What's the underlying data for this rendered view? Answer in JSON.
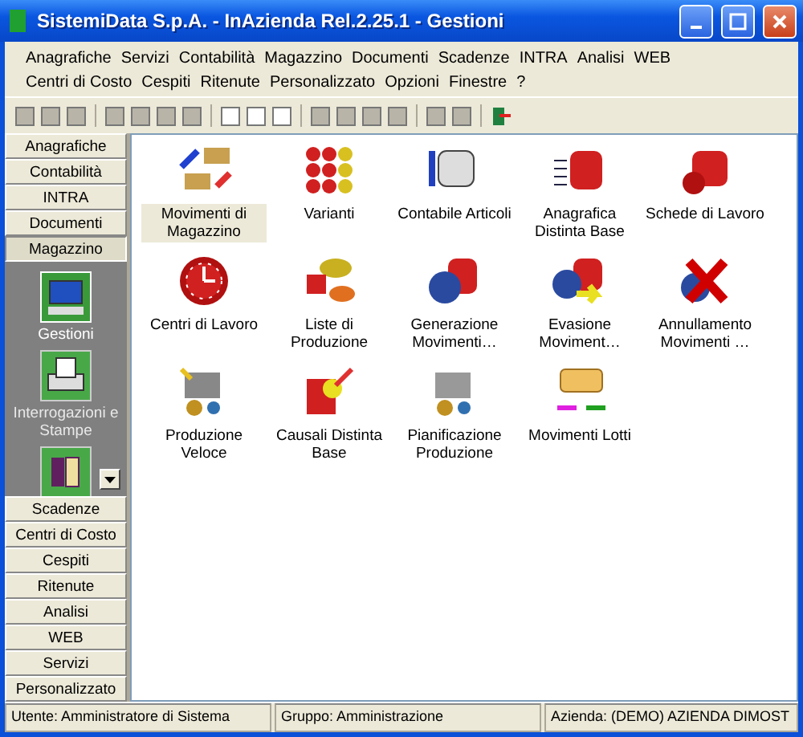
{
  "window": {
    "title": "SistemiData S.p.A. - InAzienda Rel.2.25.1 - Gestioni"
  },
  "menu": [
    "Anagrafiche",
    "Servizi",
    "Contabilità",
    "Magazzino",
    "Documenti",
    "Scadenze",
    "INTRA",
    "Analisi",
    "WEB",
    "Centri di Costo",
    "Cespiti",
    "Ritenute",
    "Personalizzato",
    "Opzioni",
    "Finestre",
    "?"
  ],
  "sidebar": {
    "groups": [
      {
        "label": "Anagrafiche",
        "expanded": false
      },
      {
        "label": "Contabilità",
        "expanded": false
      },
      {
        "label": "INTRA",
        "expanded": false
      },
      {
        "label": "Documenti",
        "expanded": false
      },
      {
        "label": "Magazzino",
        "expanded": true,
        "items": [
          {
            "label": "Gestioni",
            "selected": true
          },
          {
            "label": "Interrogazioni e Stampe",
            "selected": false
          },
          {
            "selected": false
          }
        ]
      },
      {
        "label": "Scadenze",
        "expanded": false
      },
      {
        "label": "Centri di Costo",
        "expanded": false
      },
      {
        "label": "Cespiti",
        "expanded": false
      },
      {
        "label": "Ritenute",
        "expanded": false
      },
      {
        "label": "Analisi",
        "expanded": false
      },
      {
        "label": "WEB",
        "expanded": false
      },
      {
        "label": "Servizi",
        "expanded": false
      },
      {
        "label": "Personalizzato",
        "expanded": false
      }
    ]
  },
  "items": [
    {
      "label": "Movimenti di Magazzino",
      "selected": true
    },
    {
      "label": "Varianti",
      "selected": false
    },
    {
      "label": "Contabile Articoli",
      "selected": false
    },
    {
      "label": "Anagrafica Distinta Base",
      "selected": false
    },
    {
      "label": "Schede di Lavoro",
      "selected": false
    },
    {
      "label": "Centri di Lavoro",
      "selected": false
    },
    {
      "label": "Liste di Produzione",
      "selected": false
    },
    {
      "label": "Generazione Movimenti…",
      "selected": false
    },
    {
      "label": "Evasione Moviment…",
      "selected": false
    },
    {
      "label": "Annullamento Movimenti …",
      "selected": false
    },
    {
      "label": "Produzione Veloce",
      "selected": false
    },
    {
      "label": "Causali Distinta Base",
      "selected": false
    },
    {
      "label": "Pianificazione Produzione",
      "selected": false
    },
    {
      "label": "Movimenti Lotti",
      "selected": false
    }
  ],
  "status_bar": [
    "Utente: Amministratore di Sistema",
    "Gruppo: Amministrazione",
    "Azienda: (DEMO) AZIENDA DIMOST"
  ]
}
